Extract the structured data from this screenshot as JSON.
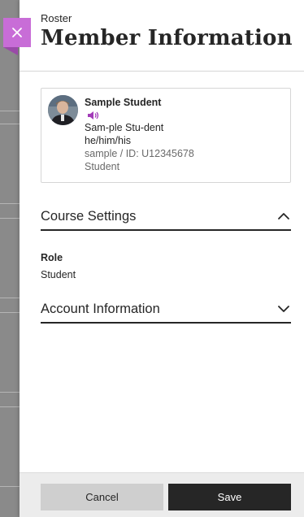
{
  "header": {
    "breadcrumb": "Roster",
    "title": "Member Information"
  },
  "colors": {
    "accent": "#c86dd7",
    "primary_button": "#262626",
    "secondary_button": "#cfcfcf"
  },
  "icons": {
    "close": "close-icon",
    "audio": "audio-speaker-icon",
    "collapse": "chevron-up-icon",
    "expand": "chevron-down-icon"
  },
  "member": {
    "name": "Sample Student",
    "pronunciation": "Sam-ple Stu-dent",
    "pronouns": "he/him/his",
    "username_id": "sample / ID: U12345678",
    "role": "Student"
  },
  "course_settings": {
    "title": "Course Settings",
    "expanded": true,
    "role_label": "Role",
    "role_value": "Student"
  },
  "account_information": {
    "title": "Account Information",
    "expanded": false
  },
  "footer": {
    "cancel_label": "Cancel",
    "save_label": "Save"
  }
}
